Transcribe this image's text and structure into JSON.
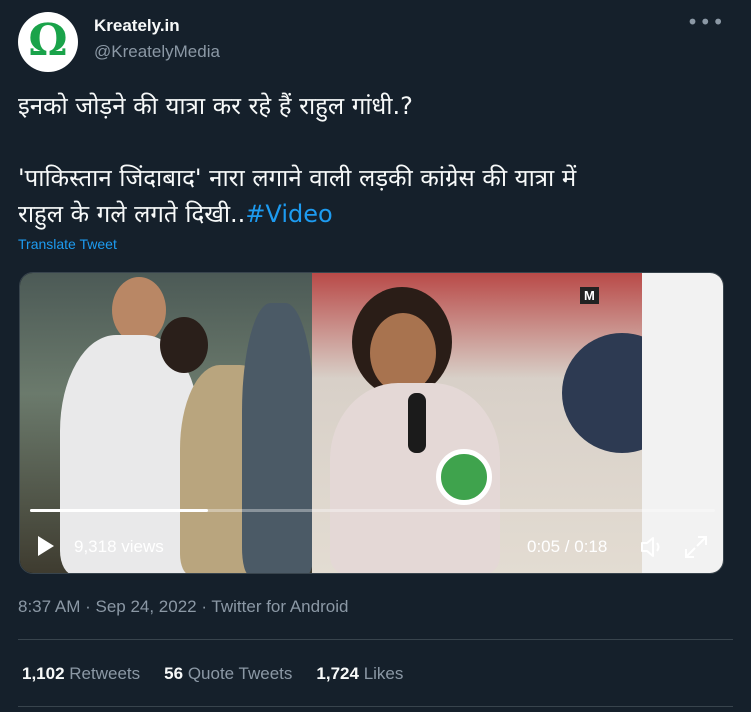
{
  "author": {
    "name": "Kreately.in",
    "handle": "@KreatelyMedia",
    "avatar_glyph": "Ω"
  },
  "more_icon_glyph": "•••",
  "tweet": {
    "line1": "इनको जोड़ने की यात्रा कर रहे हैं राहुल गांधी.?",
    "line2": "'पाकिस्तान जिंदाबाद' नारा लगाने वाली लड़की कांग्रेस की यात्रा में",
    "line3": "राहुल के गले लगते दिखी..",
    "hashtag": "#Video"
  },
  "translate_label": "Translate Tweet",
  "video": {
    "views": "9,318 views",
    "time": "0:05 / 0:18",
    "progress": 0.26,
    "watermark": "M"
  },
  "meta": "8:37 AM · Sep 24, 2022 · Twitter for Android",
  "stats": {
    "retweets": {
      "count": "1,102",
      "label": "Retweets"
    },
    "quotes": {
      "count": "56",
      "label": "Quote Tweets"
    },
    "likes": {
      "count": "1,724",
      "label": "Likes"
    }
  },
  "colors": {
    "background": "#15202b",
    "link": "#1d9bf0",
    "secondary_text": "#8b98a5",
    "brand_green": "#1aa34a"
  }
}
